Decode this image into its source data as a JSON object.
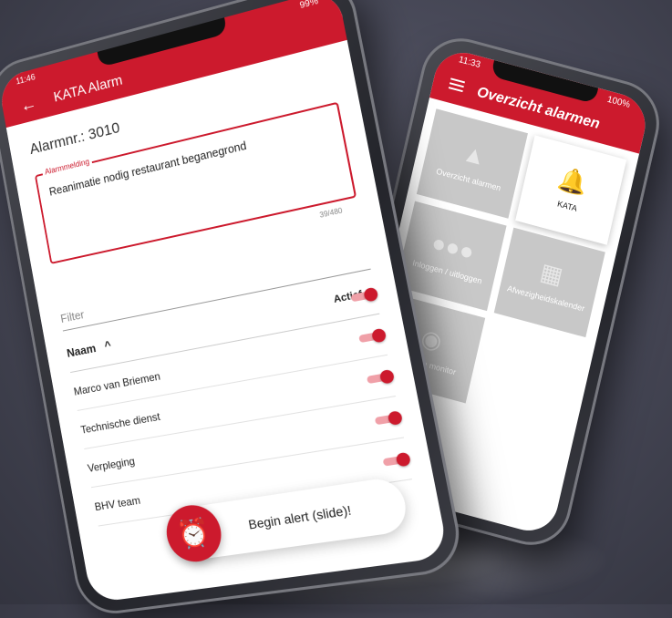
{
  "overview_phone": {
    "status": {
      "time": "11:33",
      "signal": "100%"
    },
    "title": "Overzicht alarmen",
    "tiles": [
      {
        "label": "Overzicht alarmen",
        "icon": "siren-icon",
        "active": false
      },
      {
        "label": "KATA",
        "icon": "alarm-bell-icon",
        "active": true
      },
      {
        "label": "Inloggen / uitloggen",
        "icon": "group-icon",
        "active": false
      },
      {
        "label": "Afwezigheidskalender",
        "icon": "calendar-icon",
        "active": false
      },
      {
        "label": "Realtime monitor",
        "icon": "eye-icon",
        "active": false
      }
    ]
  },
  "kata_phone": {
    "status": {
      "time": "11:46",
      "signal": "99%"
    },
    "title": "KATA Alarm",
    "alarm_nr": "Alarmnr.: 3010",
    "field": {
      "legend": "Alarmmelding",
      "value": "Reanimatie nodig restaurant beganegrond",
      "counter": "39/480"
    },
    "filter_placeholder": "Filter",
    "table": {
      "col_name": "Naam",
      "col_sort": "^",
      "col_active": "Actief",
      "rows": [
        {
          "name": "Marco van Briemen",
          "active": true
        },
        {
          "name": "Technische dienst",
          "active": true
        },
        {
          "name": "Verpleging",
          "active": true
        },
        {
          "name": "BHV team",
          "active": true
        }
      ]
    },
    "slide_label": "Begin alert (slide)!"
  },
  "colors": {
    "brand": "#cc1a2d",
    "tile_gray": "#c8c8c8"
  }
}
